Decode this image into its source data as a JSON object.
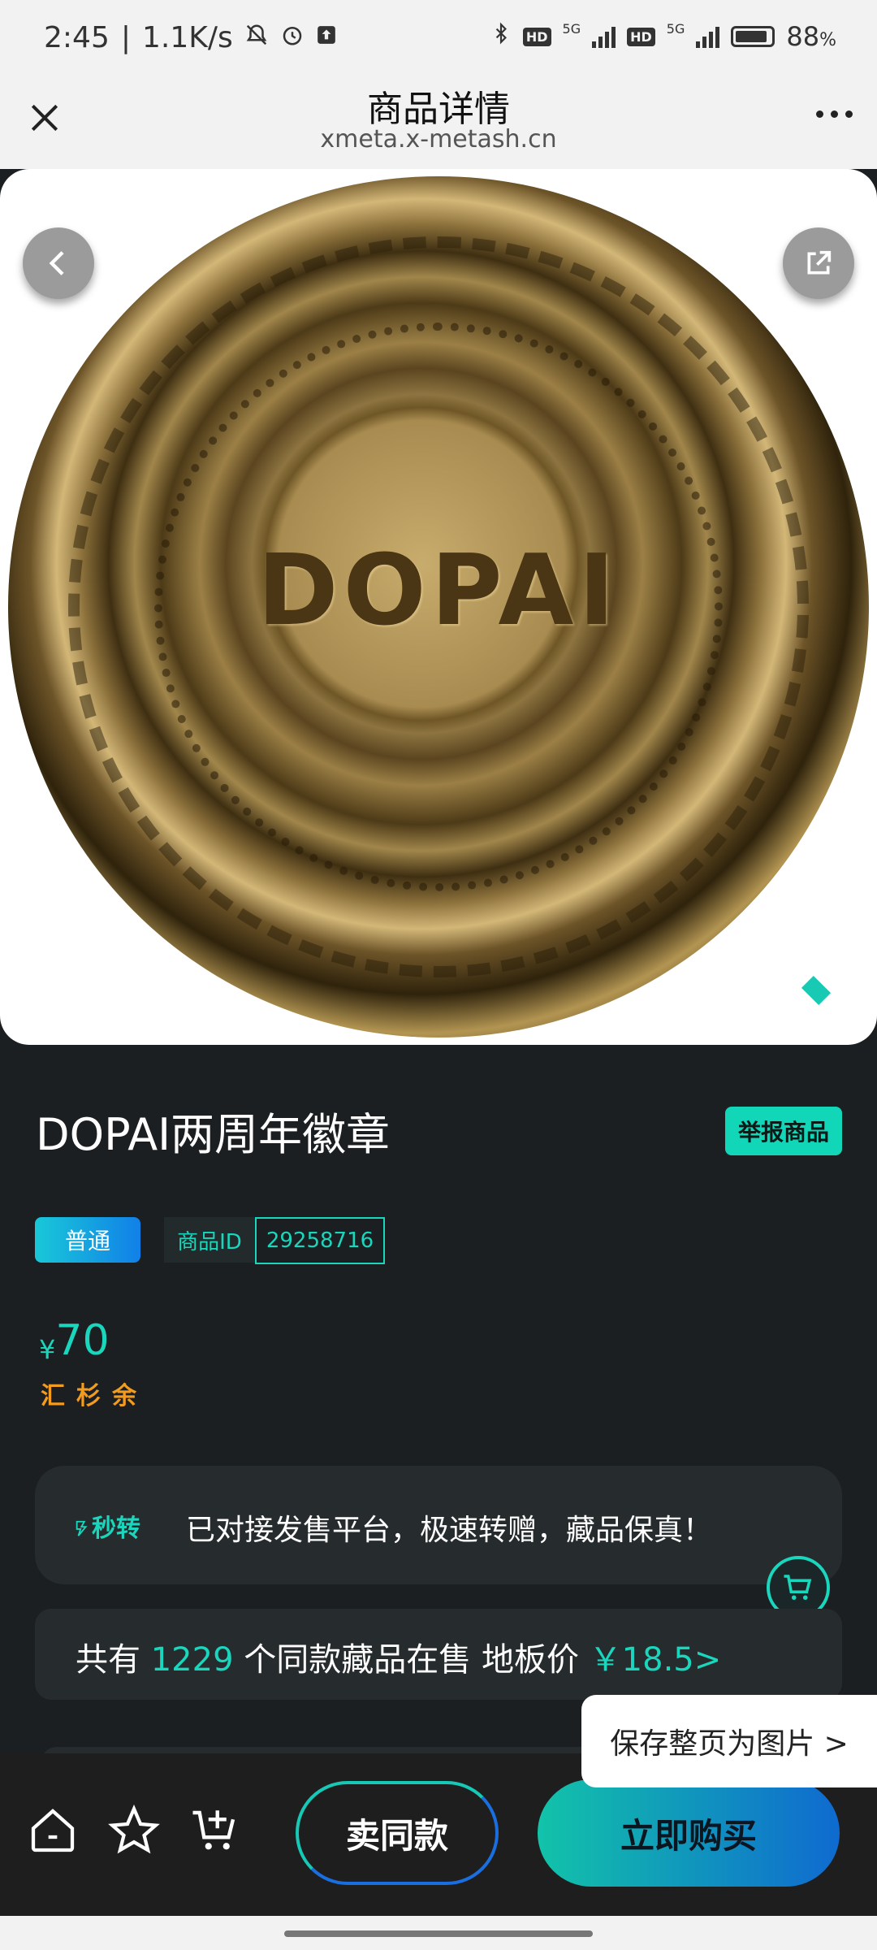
{
  "status_bar": {
    "time": "2:45",
    "speed": "1.1K/s",
    "network": "5G",
    "battery": "88"
  },
  "nav": {
    "title": "商品详情",
    "url": "xmeta.x-metash.cn"
  },
  "hero": {
    "coin_text": "DOPAI"
  },
  "product": {
    "name": "DOPAI两周年徽章",
    "report_label": "举报商品",
    "rarity_tag": "普通",
    "id_label": "商品ID",
    "id_value": "29258716",
    "currency": "¥",
    "price": "70",
    "payment_method": "汇杉余"
  },
  "transfer_card": {
    "label": "秒转",
    "text": "已对接发售平台，极速转赠，藏品保真！"
  },
  "market_card": {
    "prefix": "共有",
    "count": "1229",
    "middle": "个同款藏品在售 地板价",
    "floor_price": "￥18.5>"
  },
  "save_popup": {
    "label": "保存整页为图片 >"
  },
  "bottom_bar": {
    "sell_label": "卖同款",
    "buy_label": "立即购买"
  },
  "colors": {
    "accent": "#19d6bd",
    "price_orange": "#f29b1f",
    "background": "#1b1f21"
  }
}
